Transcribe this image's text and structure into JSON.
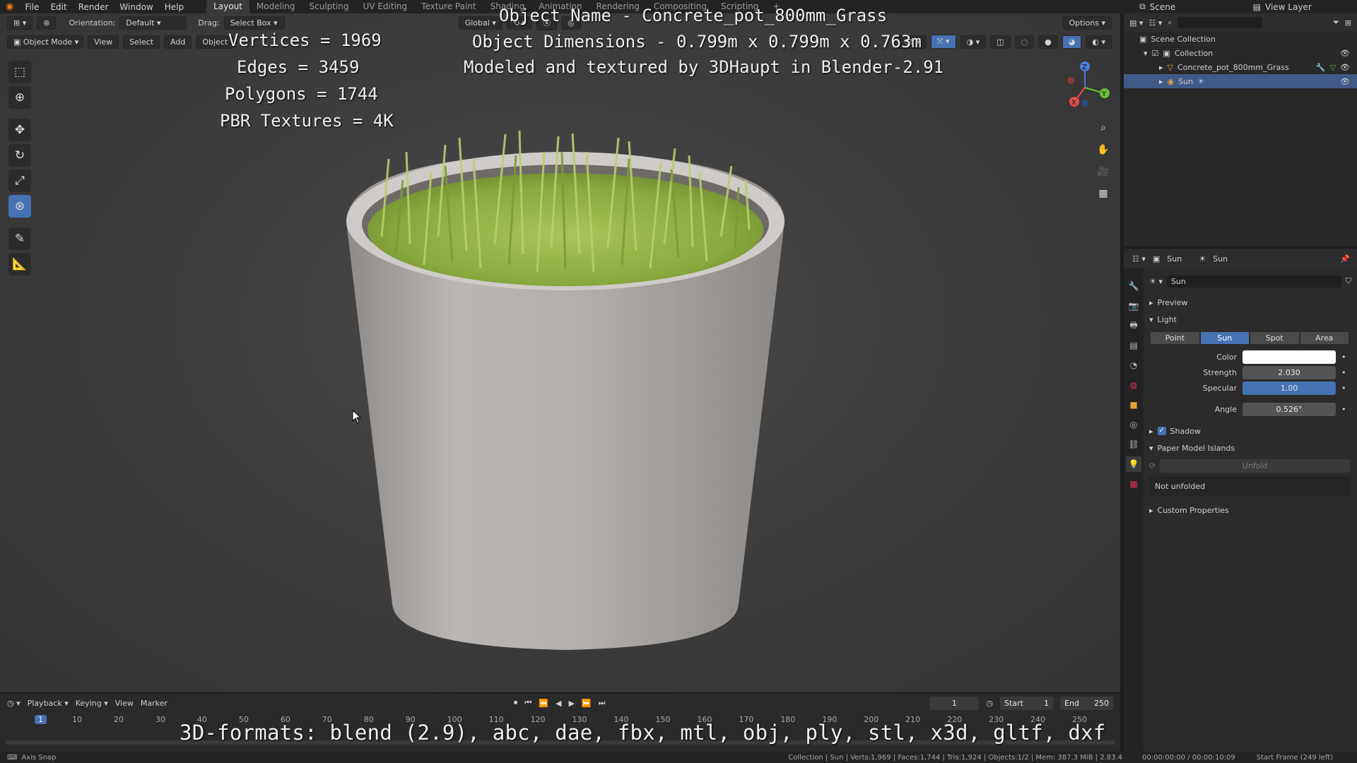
{
  "topbar": {
    "menus": [
      "File",
      "Edit",
      "Render",
      "Window",
      "Help"
    ],
    "workspaces": [
      "Layout",
      "Modeling",
      "Sculpting",
      "UV Editing",
      "Texture Paint",
      "Shading",
      "Animation",
      "Rendering",
      "Compositing",
      "Scripting"
    ],
    "active_workspace": "Layout",
    "add_tab": "+",
    "scene": "Scene",
    "view_layer": "View Layer"
  },
  "viewport_header": {
    "orientation_label": "Orientation:",
    "orientation_value": "Default",
    "drag_label": "Drag:",
    "drag_value": "Select Box",
    "transform_space": "Global",
    "options": "Options",
    "mode": "Object Mode",
    "menu_view": "View",
    "menu_select": "Select",
    "menu_add": "Add",
    "menu_object": "Object"
  },
  "overlay_text": {
    "vertices": "Vertices = 1969",
    "edges": "Edges = 3459",
    "polygons": "Polygons = 1744",
    "textures": "PBR Textures = 4K",
    "object_name": "Object Name - Concrete_pot_800mm_Grass",
    "dimensions": "Object Dimensions -  0.799m x 0.799m x 0.763m",
    "credit": "Modeled and textured by 3DHaupt in Blender-2.91",
    "formats": "3D-formats: blend (2.9), abc, dae, fbx, mtl, obj, ply, stl, x3d, gltf, dxf"
  },
  "outliner": {
    "scene_collection": "Scene Collection",
    "collection": "Collection",
    "object": "Concrete_pot_800mm_Grass",
    "light": "Sun"
  },
  "properties": {
    "header_object": "Sun",
    "header_data": "Sun",
    "datablock": "Sun",
    "preview": "Preview",
    "light_section": "Light",
    "light_types": [
      "Point",
      "Sun",
      "Spot",
      "Area"
    ],
    "active_light_type": "Sun",
    "color_label": "Color",
    "color_value": "#ffffff",
    "strength_label": "Strength",
    "strength_value": "2.030",
    "specular_label": "Specular",
    "specular_value": "1.00",
    "angle_label": "Angle",
    "angle_value": "0.526°",
    "shadow": "Shadow",
    "paper_model": "Paper Model Islands",
    "unfold": "Unfold",
    "not_unfolded": "Not unfolded",
    "custom_properties": "Custom Properties"
  },
  "timeline": {
    "playback": "Playback",
    "keying": "Keying",
    "view": "View",
    "marker": "Marker",
    "current_frame": "1",
    "start_label": "Start",
    "start_value": "1",
    "end_label": "End",
    "end_value": "250",
    "ruler": [
      "1",
      "10",
      "20",
      "30",
      "40",
      "50",
      "60",
      "70",
      "80",
      "90",
      "100",
      "110",
      "120",
      "130",
      "140",
      "150",
      "160",
      "170",
      "180",
      "190",
      "200",
      "210",
      "220",
      "230",
      "240",
      "250"
    ]
  },
  "statusbar": {
    "left": "Axis Snap",
    "stats": "Collection | Sun | Verts:1,969 | Faces:1,744 | Tris:1,924 | Objects:1/2 | Mem: 387.3 MiB | 2.83.4",
    "time": "00:00:00:00 / 00:00:10:09",
    "start_frame": "Start Frame (249 left)"
  },
  "colors": {
    "accent": "#4772b3",
    "axis_x": "#e84b4b",
    "axis_y": "#6bbf3a",
    "axis_z": "#4a7fe0"
  }
}
